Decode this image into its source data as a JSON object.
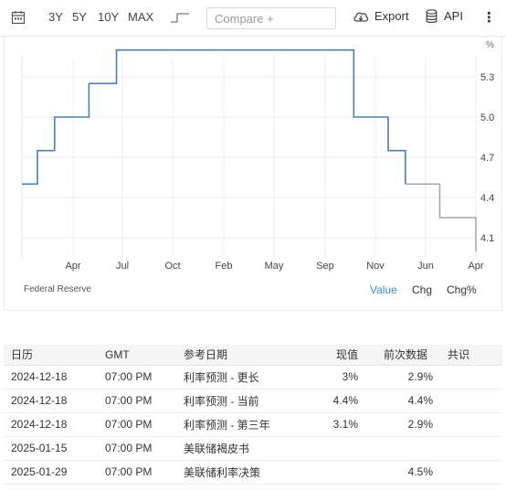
{
  "toolbar": {
    "calendar_icon": "calendar-icon",
    "ranges": [
      "3Y",
      "5Y",
      "10Y",
      "MAX"
    ],
    "chart_type_icon": "step-chart-icon",
    "compare_placeholder": "Compare +",
    "export_label": "Export",
    "api_label": "API",
    "more_icon": "more-vertical-icon"
  },
  "chart": {
    "unit_label": "%",
    "source": "Federal Reserve",
    "modes": [
      "Value",
      "Chg",
      "Chg%"
    ],
    "active_mode": "Value",
    "colors": {
      "solid_line": "#4a7fb0",
      "faded_line": "#a7a9ab",
      "grid": "#ededed"
    }
  },
  "chart_data": {
    "type": "line",
    "step": true,
    "x_ticks": [
      "Apr",
      "Jul",
      "Oct",
      "Feb",
      "May",
      "Sep",
      "Nov",
      "Jun",
      "Apr"
    ],
    "y_ticks": [
      4.1,
      4.4,
      4.7,
      5.0,
      5.3
    ],
    "ylim": [
      3.95,
      5.45
    ],
    "series": [
      {
        "x": [
          0,
          0.9,
          1.9,
          3.9,
          5.5,
          10.0,
          19.3,
          21.3,
          22.3
        ],
        "y": [
          4.5,
          4.75,
          5.0,
          5.25,
          5.5,
          5.5,
          5.0,
          4.75,
          4.5
        ],
        "style": "solid"
      },
      {
        "x": [
          22.3,
          24.3,
          26.3,
          26.4
        ],
        "y": [
          4.5,
          4.25,
          4.25,
          4.0
        ],
        "style": "faded"
      }
    ]
  },
  "table": {
    "headers": [
      "日历",
      "GMT",
      "参考日期",
      "现值",
      "前次数据",
      "共识"
    ],
    "rows": [
      [
        "2024-12-18",
        "07:00 PM",
        "利率预测 - 更长",
        "3%",
        "2.9%",
        ""
      ],
      [
        "2024-12-18",
        "07:00 PM",
        "利率预测 - 当前",
        "4.4%",
        "4.4%",
        ""
      ],
      [
        "2024-12-18",
        "07:00 PM",
        "利率预测 - 第三年",
        "3.1%",
        "2.9%",
        ""
      ],
      [
        "2025-01-15",
        "07:00 PM",
        "美联储褐皮书",
        "",
        "",
        ""
      ],
      [
        "2025-01-29",
        "07:00 PM",
        "美联储利率决策",
        "",
        "4.5%",
        ""
      ]
    ]
  }
}
